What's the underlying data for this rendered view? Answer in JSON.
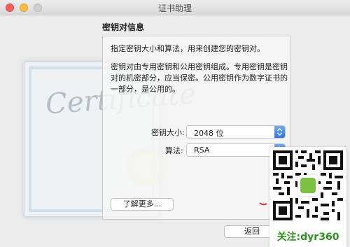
{
  "window": {
    "title": "证书助理"
  },
  "section": {
    "title": "密钥对信息"
  },
  "panel": {
    "intro": "指定密钥大小和算法，用来创建您的密钥对。",
    "description": "密钥对由专用密钥和公用密钥组成。专用密钥是密钥对的机密部分，应当保密。公用密钥作为数字证书的一部分，是公用的。",
    "key_size": {
      "label": "密钥大小:",
      "value": "2048 位"
    },
    "algorithm": {
      "label": "算法:",
      "value": "RSA"
    },
    "learn_more": "了解更多..."
  },
  "footer": {
    "back": "返回"
  },
  "watermark": {
    "caption": "关注:dyr360"
  },
  "certificate_art": {
    "word": "Certificate"
  }
}
